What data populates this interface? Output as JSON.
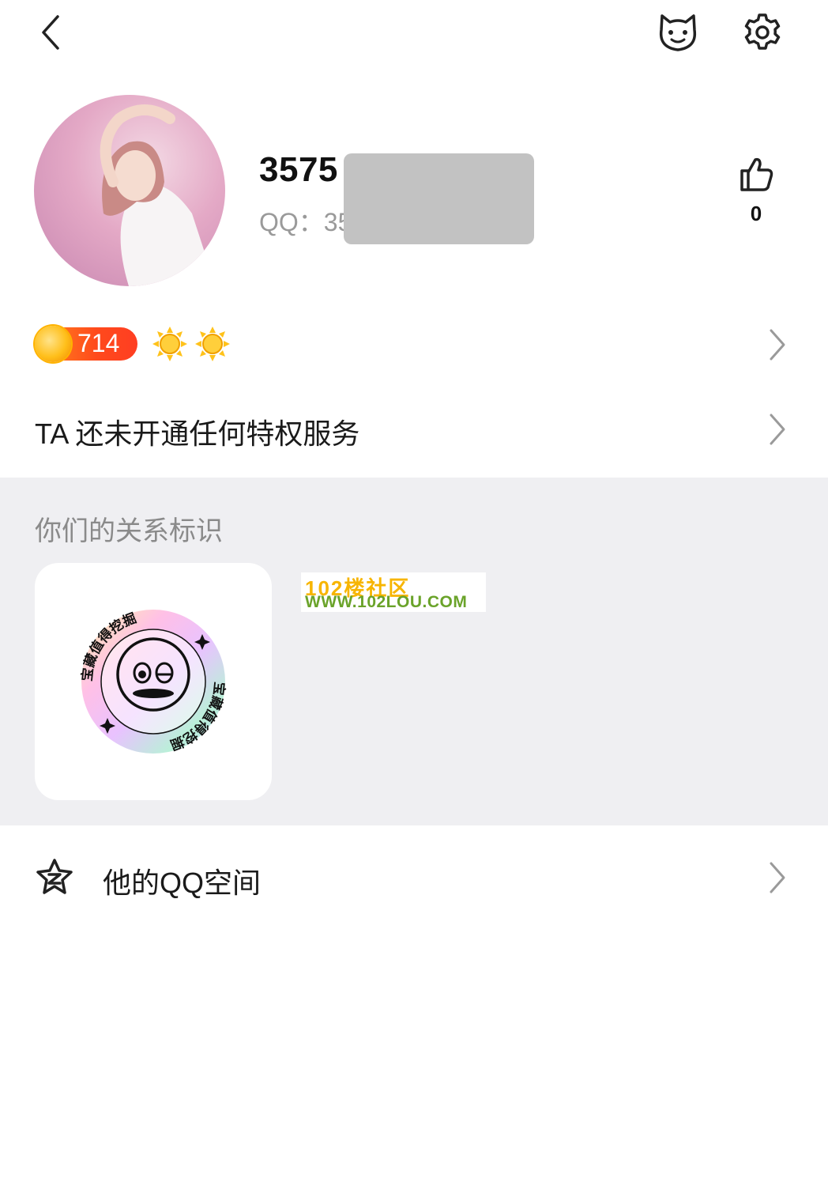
{
  "header": {
    "back_icon": "chevron-left-icon",
    "pet_icon": "pet-face-icon",
    "settings_icon": "gear-icon"
  },
  "profile": {
    "username_prefix": "3575",
    "qq_label": "QQ：",
    "qq_prefix": "35",
    "like_count": "0"
  },
  "level": {
    "value": "714",
    "suns": 2,
    "colors": {
      "pill": "#ff4a1c",
      "sun": "#ffc21a"
    }
  },
  "privilege": {
    "text": "TA 还未开通任何特权服务"
  },
  "relation": {
    "title": "你们的关系标识",
    "badge_text": "宝藏值得挖掘",
    "watermark_line1": "102楼社区",
    "watermark_line2": "WWW.102LOU.COM"
  },
  "qzone": {
    "label": "他的QQ空间",
    "icon": "qzone-star-icon"
  }
}
